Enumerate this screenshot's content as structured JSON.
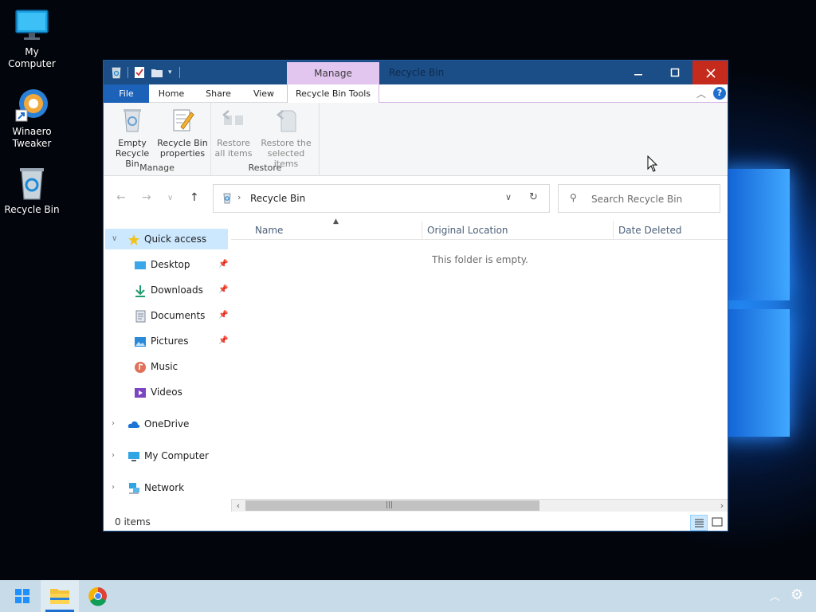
{
  "desktop": {
    "icons": [
      {
        "label": "My Computer"
      },
      {
        "label": "Winaero Tweaker"
      },
      {
        "label": "Recycle Bin"
      }
    ]
  },
  "window": {
    "title": "Recycle Bin",
    "context_tab_group": "Manage",
    "ribbon_tabs": {
      "file": "File",
      "home": "Home",
      "share": "Share",
      "view": "View",
      "context": "Recycle Bin Tools"
    },
    "ribbon": {
      "groups": {
        "manage": "Manage",
        "restore": "Restore"
      },
      "buttons": {
        "empty_line1": "Empty",
        "empty_line2": "Recycle Bin",
        "properties_line1": "Recycle Bin",
        "properties_line2": "properties",
        "restore_all_line1": "Restore",
        "restore_all_line2": "all items",
        "restore_sel_line1": "Restore the",
        "restore_sel_line2": "selected items"
      }
    },
    "address": {
      "path": "Recycle Bin"
    },
    "search": {
      "placeholder": "Search Recycle Bin"
    },
    "nav": {
      "quick_access": "Quick access",
      "items": [
        {
          "label": "Desktop"
        },
        {
          "label": "Downloads"
        },
        {
          "label": "Documents"
        },
        {
          "label": "Pictures"
        },
        {
          "label": "Music"
        },
        {
          "label": "Videos"
        }
      ],
      "onedrive": "OneDrive",
      "my_computer": "My Computer",
      "network": "Network"
    },
    "columns": {
      "name": "Name",
      "original_location": "Original Location",
      "date_deleted": "Date Deleted"
    },
    "empty_message": "This folder is empty.",
    "status": {
      "count": "0 items"
    }
  },
  "colors": {
    "titlebar": "#1b4d86",
    "context_tab": "#e3c6f0",
    "file_tab": "#1c62b9",
    "close": "#c42b1c",
    "selection": "#cce8ff",
    "taskbar": "#c8dbe8"
  }
}
